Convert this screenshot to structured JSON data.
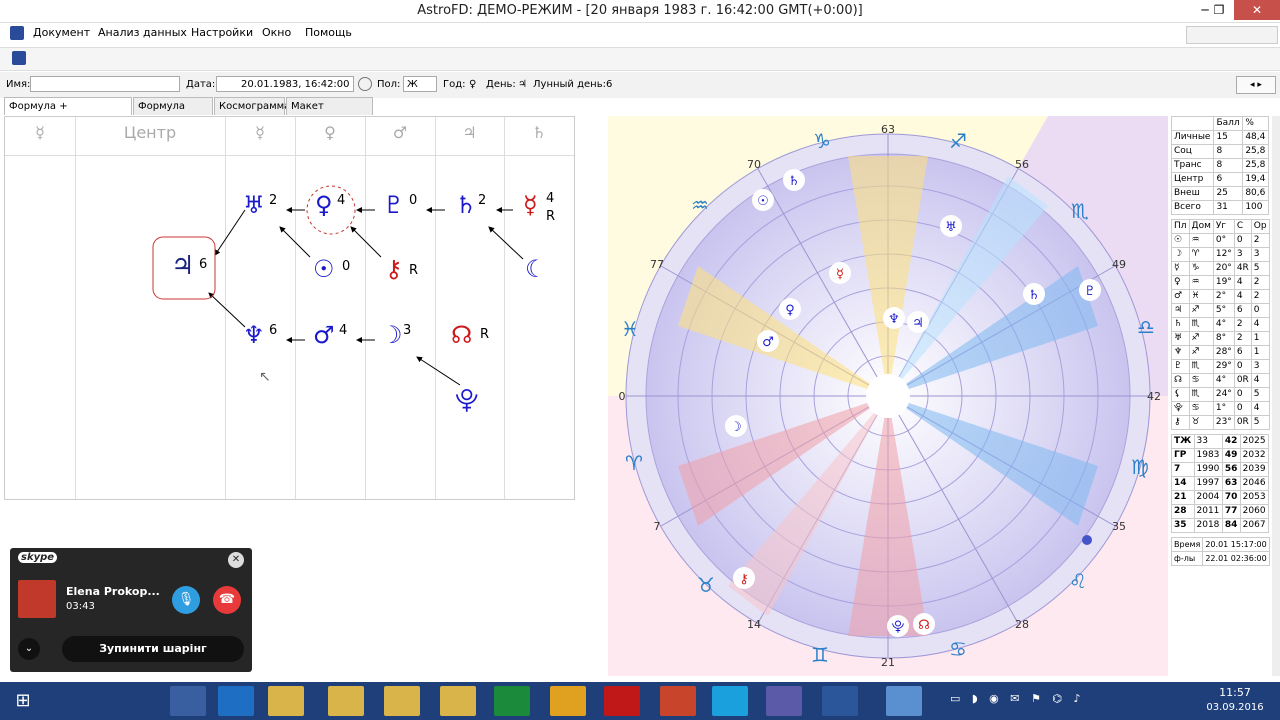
{
  "window": {
    "title": "AstroFD: ДЕМО-РЕЖИМ - [20 января 1983 г. 16:42:00 GMT(+0:00)]",
    "minimize": "─",
    "restore": "❐",
    "close": "✕"
  },
  "menu": [
    "Документ",
    "Анализ данных",
    "Настройки",
    "Окно",
    "Помощь"
  ],
  "fields": {
    "name_label": "Имя:",
    "name_value": "",
    "date_label": "Дата:",
    "date_value": "20.01.1983, 16:42:00",
    "sex_label": "Пол:",
    "sex_value": "Ж",
    "year_label": "Год:",
    "year_symbol": "♀",
    "day_label": "День:",
    "day_symbol": "♃",
    "lunar_label": "Лунный день:",
    "lunar_value": "6"
  },
  "tabs": [
    "Формула + Космограмма",
    "Формула Души",
    "Космограмма",
    "Макет страницы"
  ],
  "formula": {
    "headers": [
      "☿",
      "Центр",
      "☿",
      "♀",
      "♂",
      "♃",
      "♄"
    ],
    "nodes": [
      {
        "sym": "♃",
        "val": "6",
        "color": "#1a237e"
      },
      {
        "sym": "♅",
        "val": "2",
        "color": "#1a1acc"
      },
      {
        "sym": "♀",
        "val": "4",
        "color": "#1a1acc"
      },
      {
        "sym": "♇",
        "val": "0",
        "color": "#1a1acc"
      },
      {
        "sym": "♄",
        "val": "2",
        "color": "#1a1acc"
      },
      {
        "sym": "☿",
        "val": "4",
        "color": "#cc1a1a",
        "sub": "R"
      },
      {
        "sym": "☉",
        "val": "0",
        "color": "#1a1acc"
      },
      {
        "sym": "⚷",
        "val": "R",
        "color": "#cc1a1a"
      },
      {
        "sym": "☾",
        "val": "",
        "color": "#1a1acc"
      },
      {
        "sym": "♆",
        "val": "6",
        "color": "#1a1acc"
      },
      {
        "sym": "♂",
        "val": "4",
        "color": "#1a1acc"
      },
      {
        "sym": "☽",
        "val": "3",
        "color": "#1a1acc"
      },
      {
        "sym": "☊",
        "val": "R",
        "color": "#cc1a1a"
      },
      {
        "sym": "⯓",
        "val": "",
        "color": "#1a1acc"
      }
    ]
  },
  "chart_labels": {
    "degrees": [
      "63",
      "56",
      "49",
      "42",
      "35",
      "28",
      "21",
      "14",
      "7",
      "0",
      "77",
      "70"
    ],
    "signs": [
      "♑",
      "♐",
      "♏",
      "♎",
      "♍",
      "♌",
      "♋",
      "♊",
      "♉",
      "♈",
      "♓",
      "♒"
    ]
  },
  "score_table": {
    "headers": [
      "",
      "Балл",
      "%"
    ],
    "rows": [
      [
        "Личные",
        "15",
        "48,4"
      ],
      [
        "Соц",
        "8",
        "25,8"
      ],
      [
        "Транс",
        "8",
        "25,8"
      ],
      [
        "Центр",
        "6",
        "19,4"
      ],
      [
        "Внеш",
        "25",
        "80,6"
      ],
      [
        "Всего",
        "31",
        "100"
      ]
    ]
  },
  "planet_table": {
    "headers": [
      "Пл",
      "Дом",
      "Уг",
      "С",
      "Ор"
    ],
    "rows": [
      [
        "☉",
        "♒",
        "0°",
        "0",
        "2"
      ],
      [
        "☽",
        "♈",
        "12°",
        "3",
        "3"
      ],
      [
        "☿",
        "♑",
        "20°",
        "4R",
        "5"
      ],
      [
        "♀",
        "♒",
        "19°",
        "4",
        "2"
      ],
      [
        "♂",
        "♓",
        "2°",
        "4",
        "2"
      ],
      [
        "♃",
        "♐",
        "5°",
        "6",
        "0"
      ],
      [
        "♄",
        "♏",
        "4°",
        "2",
        "4"
      ],
      [
        "♅",
        "♐",
        "8°",
        "2",
        "1"
      ],
      [
        "♆",
        "♐",
        "28°",
        "6",
        "1"
      ],
      [
        "♇",
        "♏",
        "29°",
        "0",
        "3"
      ],
      [
        "☊",
        "♋",
        "4°",
        "0R",
        "4"
      ],
      [
        "⚸",
        "♏",
        "24°",
        "0",
        "5"
      ],
      [
        "⯓",
        "♋",
        "1°",
        "0",
        "4"
      ],
      [
        "⚷",
        "♉",
        "23°",
        "0R",
        "5"
      ]
    ]
  },
  "years_table": {
    "rows": [
      [
        "ТЖ",
        "33",
        "42",
        "2025"
      ],
      [
        "ГР",
        "1983",
        "49",
        "2032"
      ],
      [
        "7",
        "1990",
        "56",
        "2039"
      ],
      [
        "14",
        "1997",
        "63",
        "2046"
      ],
      [
        "21",
        "2004",
        "70",
        "2053"
      ],
      [
        "28",
        "2011",
        "77",
        "2060"
      ],
      [
        "35",
        "2018",
        "84",
        "2067"
      ]
    ]
  },
  "times_table": {
    "rows": [
      [
        "Время",
        "20.01 15:17:00"
      ],
      [
        "ф-лы",
        "22.01 02:36:00"
      ]
    ]
  },
  "skype": {
    "logo": "skype",
    "caller": "Elena Prokop...",
    "duration": "03:43",
    "stop_label": "Зупинити шарінг"
  },
  "taskbar": {
    "time": "11:57",
    "date": "03.09.2016"
  }
}
